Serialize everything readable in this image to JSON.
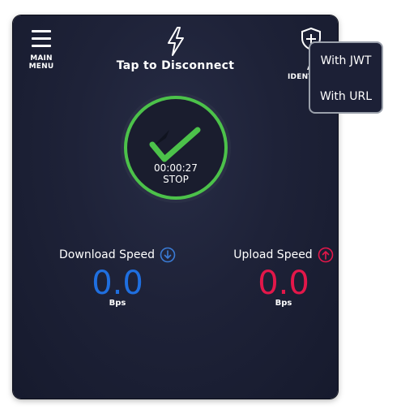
{
  "header": {
    "menu_label_line1": "MAIN",
    "menu_label_line2": "MENU",
    "title": "Tap to Disconnect",
    "identity_label_line1": "A",
    "identity_label_line2": "IDENTI"
  },
  "status": {
    "timer": "00:00:27",
    "action": "STOP",
    "state_color": "#4cc24a"
  },
  "download": {
    "label": "Download Speed",
    "value": "0.0",
    "unit": "Bps",
    "color": "#1f6fe0"
  },
  "upload": {
    "label": "Upload Speed",
    "value": "0.0",
    "unit": "Bps",
    "color": "#e3174a"
  },
  "identity_menu": {
    "items": [
      "With JWT",
      "With URL"
    ]
  },
  "icons": {
    "menu": "hamburger-icon",
    "bolt": "lightning-bolt-icon",
    "identity": "shield-plus-icon",
    "connected": "checkmark-icon",
    "download": "arrow-down-circle-icon",
    "upload": "arrow-up-circle-icon"
  }
}
